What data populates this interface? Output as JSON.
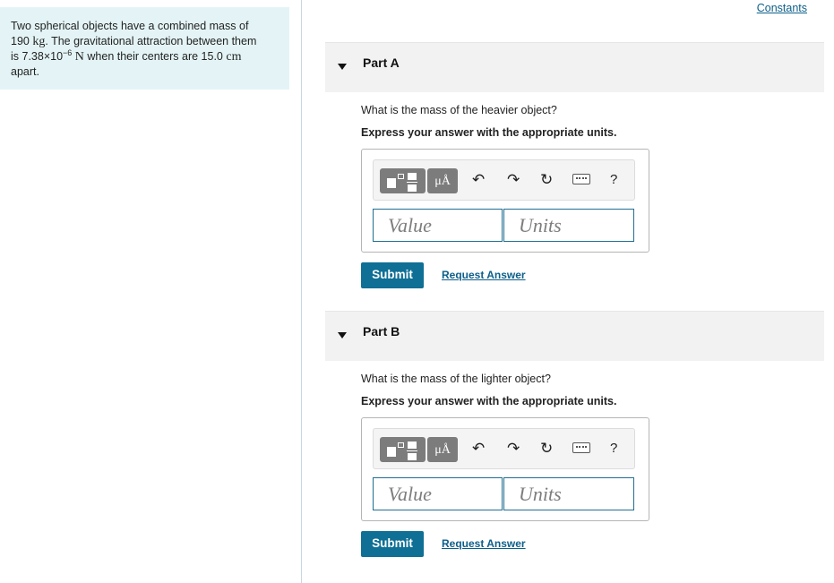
{
  "problem": {
    "line1": "Two spherical objects have a combined mass of",
    "mass_value": "190",
    "mass_unit": "kg",
    "line2_rest": ". The gravitational attraction between them",
    "line3_prefix": "is 7.38×10",
    "force_exp": "−6",
    "force_unit": "N",
    "line3_mid": " when their centers are 15.0",
    "dist_unit": "cm",
    "line4": "apart."
  },
  "constants_label": "Constants",
  "toolbar": {
    "units_label": "μÅ",
    "undo_icon": "undo-icon",
    "redo_icon": "redo-icon",
    "reset_icon": "reset-icon",
    "keyboard_icon": "keyboard-icon",
    "help_label": "?"
  },
  "parts": [
    {
      "title": "Part A",
      "question": "What is the mass of the heavier object?",
      "instruction": "Express your answer with the appropriate units.",
      "value_placeholder": "Value",
      "units_placeholder": "Units",
      "submit_label": "Submit",
      "request_label": "Request Answer"
    },
    {
      "title": "Part B",
      "question": "What is the mass of the lighter object?",
      "instruction": "Express your answer with the appropriate units.",
      "value_placeholder": "Value",
      "units_placeholder": "Units",
      "submit_label": "Submit",
      "request_label": "Request Answer"
    }
  ],
  "colors": {
    "accent": "#0f6f95",
    "problem_bg": "#e4f4f6",
    "part_header_bg": "#f2f2f2"
  }
}
